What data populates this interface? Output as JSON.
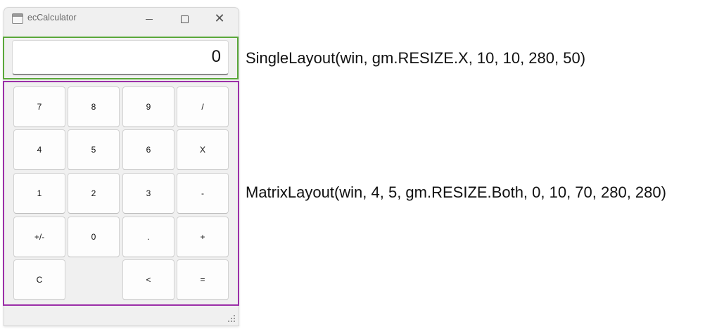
{
  "window": {
    "title": "ecCalculator"
  },
  "display": {
    "value": "0"
  },
  "keypad": {
    "rows": [
      [
        "7",
        "8",
        "9",
        "/"
      ],
      [
        "4",
        "5",
        "6",
        "X"
      ],
      [
        "1",
        "2",
        "3",
        "-"
      ],
      [
        "+/-",
        "0",
        ".",
        "+"
      ],
      [
        "C",
        "",
        "<",
        "="
      ]
    ]
  },
  "annotations": {
    "single_layout": "SingleLayout(win, gm.RESIZE.X, 10, 10, 280, 50)",
    "matrix_layout": "MatrixLayout(win, 4, 5, gm.RESIZE.Both, 0, 10, 70, 280, 280)"
  },
  "colors": {
    "single_layout_highlight": "#5aa83a",
    "matrix_layout_highlight": "#9b2fa8"
  }
}
